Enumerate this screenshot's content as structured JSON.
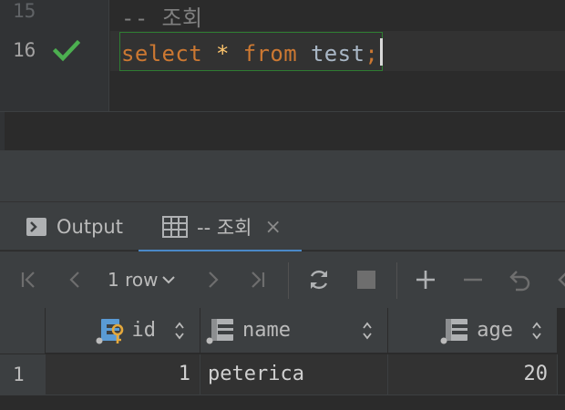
{
  "editor": {
    "lines": [
      {
        "number": "15",
        "text": "-- 조회"
      },
      {
        "number": "16",
        "tokens": {
          "kw1": "select",
          "op": "*",
          "kw2": "from",
          "table": "test",
          "end": ";"
        }
      }
    ],
    "status_icon": "green-check-icon"
  },
  "tabs": {
    "output_label": "Output",
    "result_label": "-- 조회",
    "close_glyph": "×"
  },
  "toolbar": {
    "row_count": "1 row",
    "buttons": [
      "first-page-icon",
      "previous-page-icon",
      "next-page-icon",
      "last-page-icon",
      "refresh-icon",
      "stop-icon",
      "add-row-icon",
      "delete-row-icon",
      "revert-icon"
    ]
  },
  "grid": {
    "columns": [
      {
        "label": "id",
        "icon": "primary-key-column-icon"
      },
      {
        "label": "name",
        "icon": "column-icon"
      },
      {
        "label": "age",
        "icon": "column-icon"
      }
    ],
    "rows": [
      {
        "row_number": "1",
        "id": "1",
        "name": "peterica",
        "age": "20"
      }
    ]
  },
  "colors": {
    "keyword": "#cc7832",
    "operator": "#ffc66d",
    "identifier": "#a9b7c6",
    "success_check": "#4caf50",
    "primary_key": "#e4a83c",
    "column_icon": "#5a9bd5",
    "active_tab_underline": "#4a88c7"
  }
}
